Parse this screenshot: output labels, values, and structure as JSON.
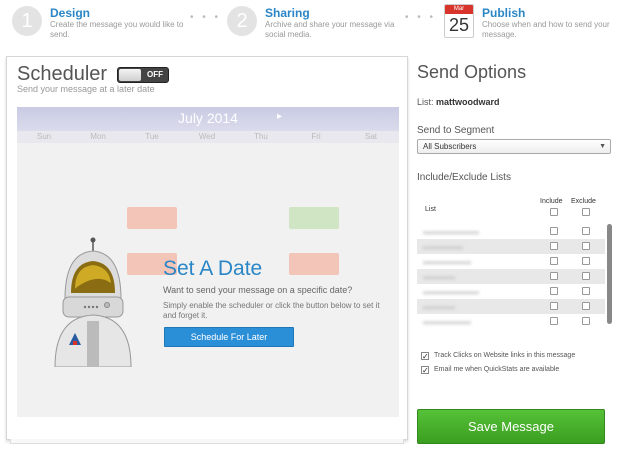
{
  "steps": [
    {
      "num": "1",
      "title": "Design",
      "desc": "Create the message you would like to send."
    },
    {
      "num": "2",
      "title": "Sharing",
      "desc": "Archive and share your message via social media."
    },
    {
      "title": "Publish",
      "desc": "Choose when and how to send your message.",
      "icon_month": "Mar",
      "icon_day": "25"
    }
  ],
  "scheduler": {
    "title": "Scheduler",
    "toggle_label": "OFF",
    "subtitle": "Send your message at a later date",
    "calendar": {
      "month_label": "July 2014",
      "next_icon": "▸",
      "weekdays": [
        "Sun",
        "Mon",
        "Tue",
        "Wed",
        "Thu",
        "Fri",
        "Sat"
      ]
    },
    "overlay": {
      "title": "Set A Date",
      "question": "Want to send your message on a specific date?",
      "description": "Simply enable the scheduler or click the button below to set it and forget it.",
      "button_label": "Schedule For Later"
    }
  },
  "send_options": {
    "title": "Send Options",
    "list_prefix": "List:",
    "list_name": "mattwoodward",
    "segment_label": "Send to Segment",
    "segment_value": "All Subscribers",
    "include_exclude_label": "Include/Exclude Lists",
    "col_list": "List",
    "col_include": "Include",
    "col_exclude": "Exclude",
    "options": [
      {
        "label": "Track Clicks on Website links in this message",
        "checked": true
      },
      {
        "label": "Email me when QuickStats are available",
        "checked": true
      }
    ],
    "save_label": "Save Message"
  }
}
